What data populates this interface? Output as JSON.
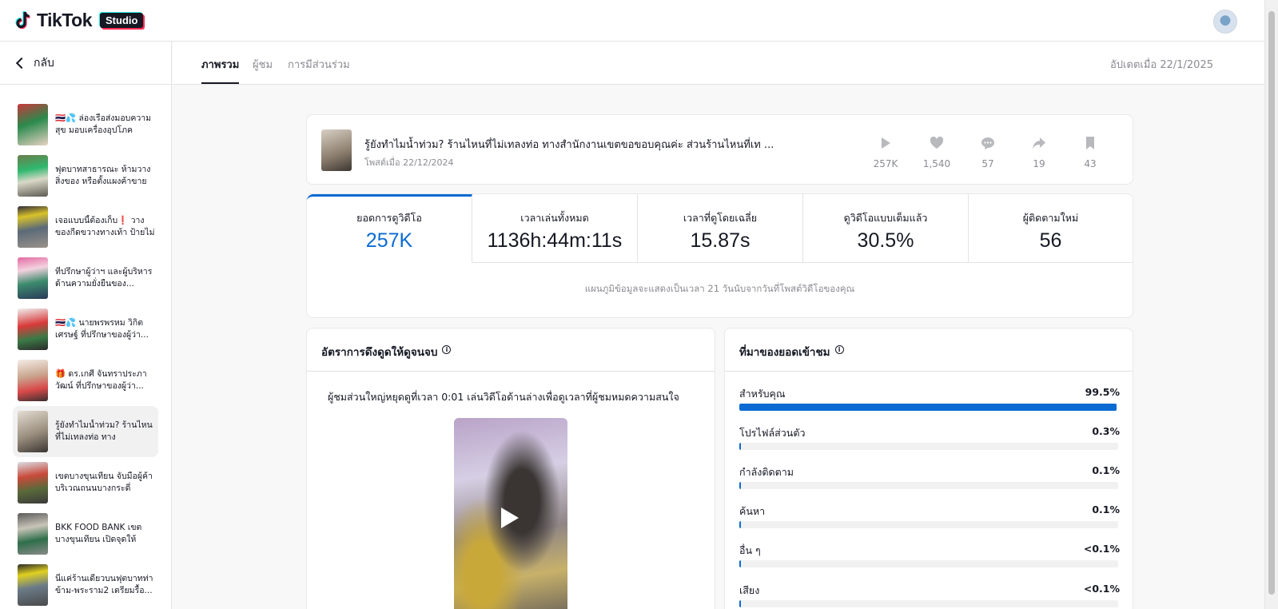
{
  "header": {
    "brand": "TikTok",
    "badge": "Studio"
  },
  "sidebar": {
    "back_label": "กลับ",
    "items": [
      {
        "title": "🇹🇭💦 ล่องเรือส่งมอบความสุข มอบเครื่องอุปโภคบริโภ...",
        "active": false
      },
      {
        "title": "ฟุตบาทสาธารณะ ห้ามวางสิ่งของ หรือตั้งแผงค้าขาย ...",
        "active": false
      },
      {
        "title": "เจอแบบนี้ต้องเก็บ❗ วางของกีดขวางทางเท้า ป้ายไม่ได้...",
        "active": false
      },
      {
        "title": "ที่ปรึกษาผู้ว่าฯ และผู้บริหารด้านความยั่งยืนของ...",
        "active": false
      },
      {
        "title": "🇹🇭💦 นายพรพรหม วิกิตเศรษฐ์ ที่ปรึกษาของผู้ว่า...",
        "active": false
      },
      {
        "title": "🎁 ดร.เกศี จันทราประภาวัฒน์ ที่ปรึกษาของผู้ว่า...",
        "active": false
      },
      {
        "title": "รู้ยังทำไมน้ำท่วม? ร้านไหนที่ไม่เทลงท่อ ทางสำนักงาน...",
        "active": true
      },
      {
        "title": "เขตบางขุนเทียน จับมือผู้ค้าบริเวณถนนบางกระดี่ ร่วมใจ...",
        "active": false
      },
      {
        "title": "BKK FOOD BANK เขตบางขุนเทียน เปิดจุดให้บริก...",
        "active": false
      },
      {
        "title": "นี่แค่ร้านเดียวบนฟุตบาทท่าข้าม-พระราม2 เตรียมรื้อ...",
        "active": false
      }
    ]
  },
  "tabs": {
    "overview": "ภาพรวม",
    "viewers": "ผู้ชม",
    "engagement": "การมีส่วนร่วม",
    "updated": "อัปเดตเมื่อ 22/1/2025"
  },
  "video": {
    "title": "รู้ยังทำไมน้ำท่วม? ร้านไหนที่ไม่เทลงท่อ ทางสำนักงานเขตขอขอบคุณค่ะ ส่วนร้านไหนที่เท ...",
    "posted": "โพสต์เมื่อ 22/12/2024",
    "stats": {
      "plays": "257K",
      "likes": "1,540",
      "comments": "57",
      "shares": "19",
      "saves": "43"
    }
  },
  "metrics": {
    "items": [
      {
        "label": "ยอดการดูวิดีโอ",
        "value": "257K"
      },
      {
        "label": "เวลาเล่นทั้งหมด",
        "value": "1136h:44m:11s"
      },
      {
        "label": "เวลาที่ดูโดยเฉลี่ย",
        "value": "15.87s"
      },
      {
        "label": "ดูวิดีโอแบบเต็มแล้ว",
        "value": "30.5%"
      },
      {
        "label": "ผู้ติดตามใหม่",
        "value": "56"
      }
    ],
    "note": "แผนภูมิข้อมูลจะแสดงเป็นเวลา 21 วันนับจากวันที่โพสต์วิดีโอของคุณ"
  },
  "retention": {
    "title": "อัตราการดึงดูดให้ดูจนจบ",
    "text": "ผู้ชมส่วนใหญ่หยุดดูที่เวลา 0:01 เล่นวิดีโอด้านล่างเพื่อดูเวลาที่ผู้ชมหมดความสนใจ"
  },
  "sources": {
    "title": "ที่มาของยอดเข้าชม",
    "items": [
      {
        "label": "สำหรับคุณ",
        "value": "99.5%",
        "percent": 99.5
      },
      {
        "label": "โปรไฟล์ส่วนตัว",
        "value": "0.3%",
        "percent": 0.3
      },
      {
        "label": "กำลังติดตาม",
        "value": "0.1%",
        "percent": 0.1
      },
      {
        "label": "ค้นหา",
        "value": "0.1%",
        "percent": 0.1
      },
      {
        "label": "อื่น ๆ",
        "value": "<0.1%",
        "percent": 0.05
      },
      {
        "label": "เสียง",
        "value": "<0.1%",
        "percent": 0.05
      }
    ]
  },
  "colors": {
    "accent": "#0b6bd3",
    "text": "#161823",
    "muted": "#8a8b91"
  }
}
